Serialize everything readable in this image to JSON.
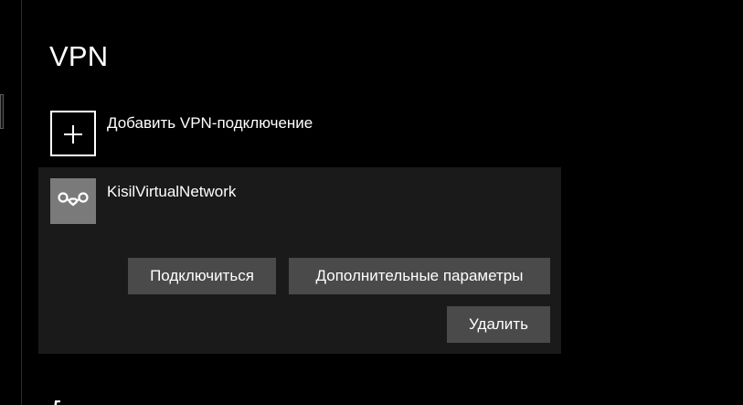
{
  "page": {
    "title": "VPN",
    "bottom_cutoff_text": "Д"
  },
  "add_vpn": {
    "label": "Добавить VPN-подключение",
    "icon": "plus-icon"
  },
  "connection": {
    "name": "KisilVirtualNetwork",
    "icon": "vpn-connection-icon",
    "icon_tile_color": "#7a7a7a",
    "buttons": {
      "connect_label": "Подключиться",
      "advanced_label": "Дополнительные параметры",
      "delete_label": "Удалить"
    }
  },
  "colors": {
    "background": "#000000",
    "card": "#1a1a1a",
    "button": "#4a4a4a",
    "text": "#ffffff"
  }
}
